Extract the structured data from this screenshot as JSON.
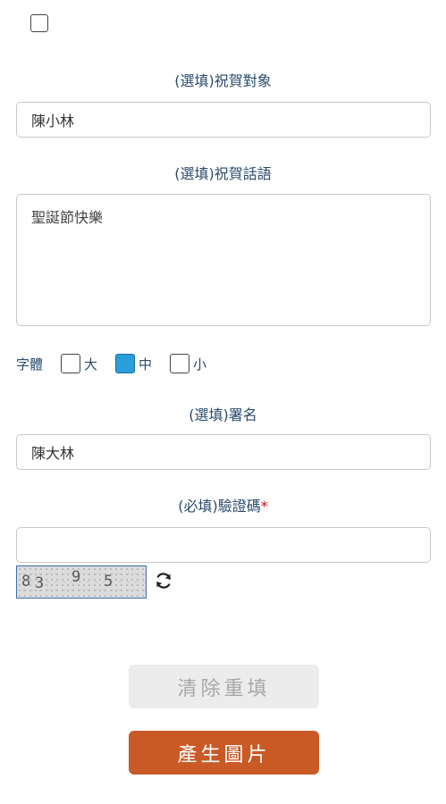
{
  "form": {
    "recipient": {
      "label": "(選填)祝賀對象",
      "value": "陳小林"
    },
    "message": {
      "label": "(選填)祝賀話語",
      "value": "聖誕節快樂"
    },
    "font_size": {
      "label": "字體",
      "options": [
        {
          "label": "大",
          "checked": false
        },
        {
          "label": "中",
          "checked": true
        },
        {
          "label": "小",
          "checked": false
        }
      ]
    },
    "signature": {
      "label": "(選填)署名",
      "value": "陳大林"
    },
    "captcha": {
      "label": "(必填)驗證碼",
      "required_mark": "*",
      "value": "",
      "image_chars": [
        "8",
        "3",
        "9",
        "5"
      ]
    }
  },
  "buttons": {
    "clear_label": "清除重填",
    "generate_label": "產生圖片"
  },
  "icons": {
    "refresh": "refresh-icon"
  },
  "colors": {
    "label": "#2b4a6b",
    "checked": "#2a9ed8",
    "primary_button": "#c95a26",
    "disabled_button": "#ececec",
    "required": "#d0021b"
  }
}
